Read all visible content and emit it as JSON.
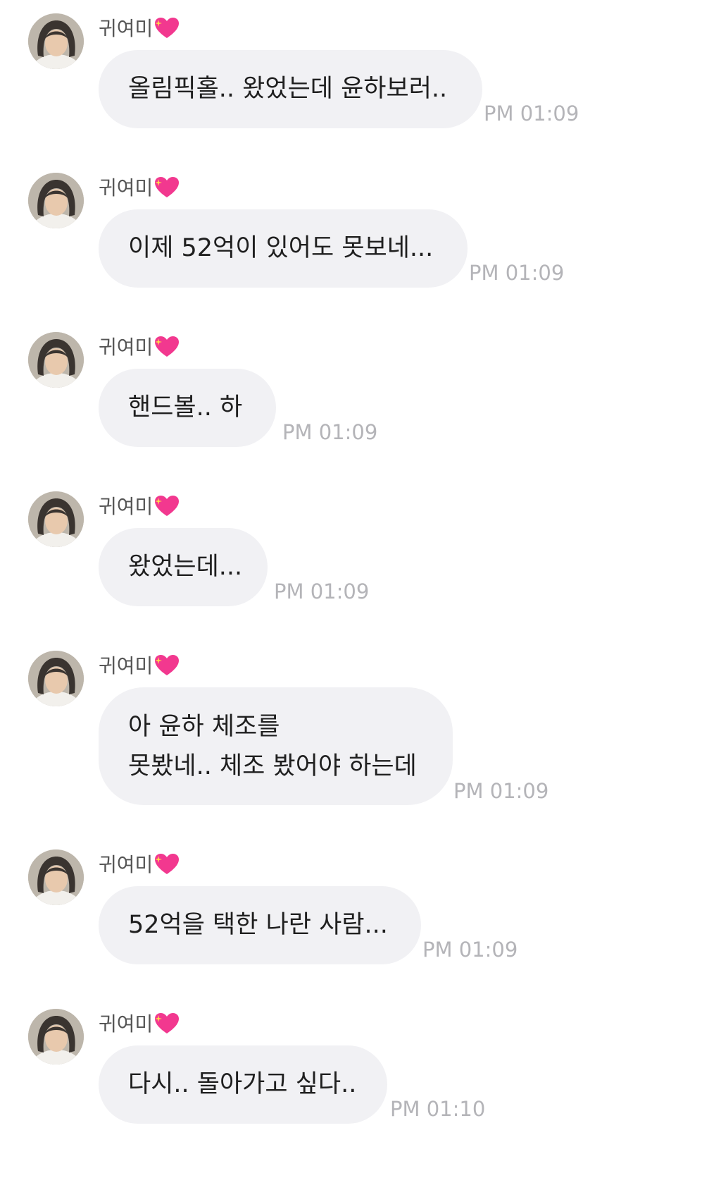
{
  "sender_name": "귀여미",
  "sender_emoji": "sparkling-heart",
  "colors": {
    "bubble": "#f1f1f4",
    "timestamp": "#b4b4b8",
    "heart": "#f2388f"
  },
  "messages": [
    {
      "text": "올림픽홀.. 왔었는데 윤하보러..",
      "time": "PM 01:09"
    },
    {
      "text": "이제 52억이 있어도 못보네...",
      "time": "PM 01:09"
    },
    {
      "text": "핸드볼.. 하",
      "time": "PM 01:09"
    },
    {
      "text": "왔었는데...",
      "time": "PM 01:09"
    },
    {
      "text": "아 윤하 체조를\n못봤네.. 체조 봤어야 하는데",
      "time": "PM 01:09"
    },
    {
      "text": "52억을 택한 나란 사람...",
      "time": "PM 01:09"
    },
    {
      "text": "다시.. 돌아가고 싶다..",
      "time": "PM 01:10"
    }
  ]
}
